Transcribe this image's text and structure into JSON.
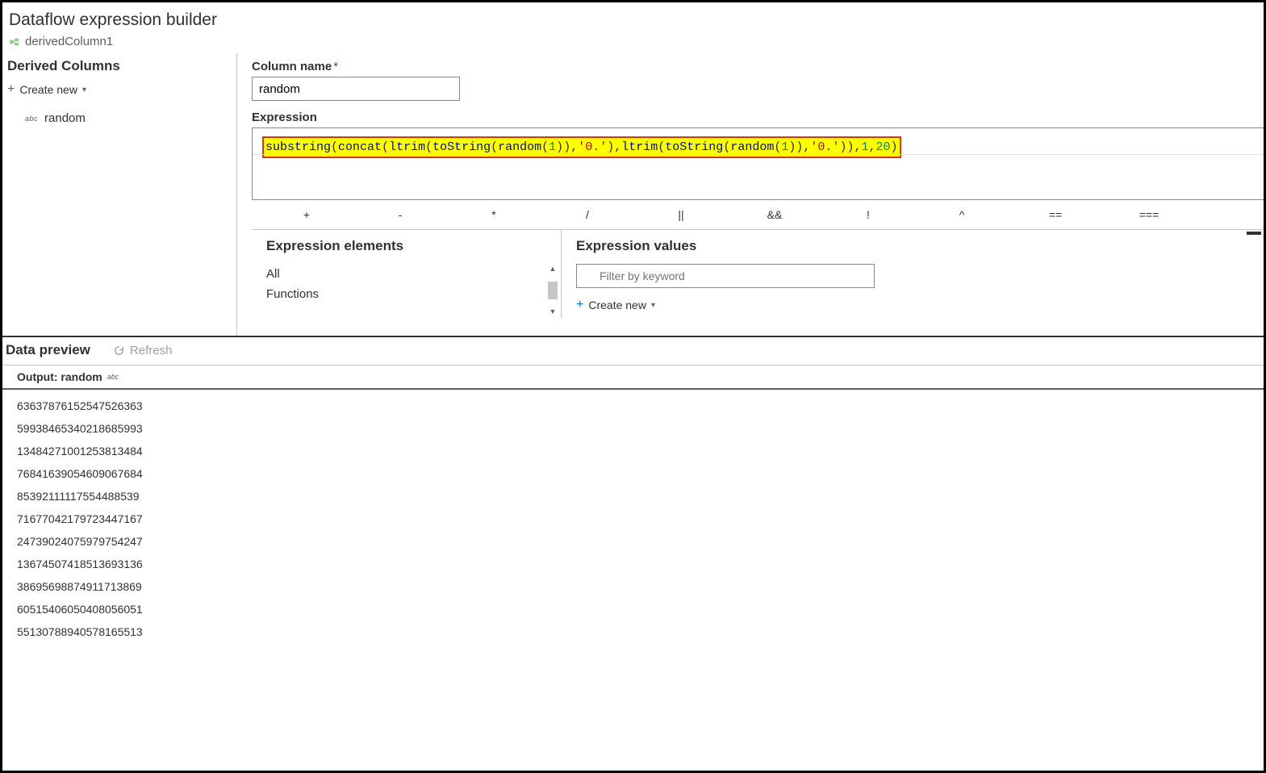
{
  "header": {
    "title": "Dataflow expression builder",
    "node_name": "derivedColumn1"
  },
  "sidebar": {
    "title": "Derived Columns",
    "create_new": "Create new",
    "items": [
      {
        "type_abbr": "abc",
        "name": "random"
      }
    ]
  },
  "main": {
    "column_name_label": "Column name",
    "column_name_value": "random",
    "expression_label": "Expression",
    "expression_tokens": [
      {
        "t": "fn",
        "v": "substring"
      },
      {
        "t": "punc",
        "v": "("
      },
      {
        "t": "fn",
        "v": "concat"
      },
      {
        "t": "punc",
        "v": "("
      },
      {
        "t": "fn",
        "v": "ltrim"
      },
      {
        "t": "punc",
        "v": "("
      },
      {
        "t": "fn",
        "v": "toString"
      },
      {
        "t": "punc",
        "v": "("
      },
      {
        "t": "fn",
        "v": "random"
      },
      {
        "t": "punc",
        "v": "("
      },
      {
        "t": "num",
        "v": "1"
      },
      {
        "t": "punc",
        "v": ")"
      },
      {
        "t": "punc",
        "v": ")"
      },
      {
        "t": "punc",
        "v": ","
      },
      {
        "t": "str",
        "v": "'0.'"
      },
      {
        "t": "punc",
        "v": ")"
      },
      {
        "t": "punc",
        "v": ","
      },
      {
        "t": "fn",
        "v": "ltrim"
      },
      {
        "t": "punc",
        "v": "("
      },
      {
        "t": "fn",
        "v": "toString"
      },
      {
        "t": "punc",
        "v": "("
      },
      {
        "t": "fn",
        "v": "random"
      },
      {
        "t": "punc",
        "v": "("
      },
      {
        "t": "num",
        "v": "1"
      },
      {
        "t": "punc",
        "v": ")"
      },
      {
        "t": "punc",
        "v": ")"
      },
      {
        "t": "punc",
        "v": ","
      },
      {
        "t": "str",
        "v": "'0.'"
      },
      {
        "t": "punc",
        "v": ")"
      },
      {
        "t": "punc",
        "v": ")"
      },
      {
        "t": "punc",
        "v": ","
      },
      {
        "t": "num",
        "v": "1"
      },
      {
        "t": "punc",
        "v": ","
      },
      {
        "t": "num",
        "v": "20"
      },
      {
        "t": "punc",
        "v": ")"
      }
    ],
    "operators": [
      "+",
      "-",
      "*",
      "/",
      "||",
      "&&",
      "!",
      "^",
      "==",
      "==="
    ]
  },
  "expression_elements": {
    "title": "Expression elements",
    "items": [
      "All",
      "Functions"
    ]
  },
  "expression_values": {
    "title": "Expression values",
    "filter_placeholder": "Filter by keyword",
    "create_new": "Create new"
  },
  "data_preview": {
    "title": "Data preview",
    "refresh": "Refresh",
    "output_label": "Output:",
    "output_name": "random",
    "output_type": "abc",
    "rows": [
      "63637876152547526363",
      "59938465340218685993",
      "13484271001253813484",
      "76841639054609067684",
      "85392111117554488539",
      "71677042179723447167",
      "24739024075979754247",
      "13674507418513693136",
      "38695698874911713869",
      "60515406050408056051",
      "55130788940578165513"
    ]
  }
}
